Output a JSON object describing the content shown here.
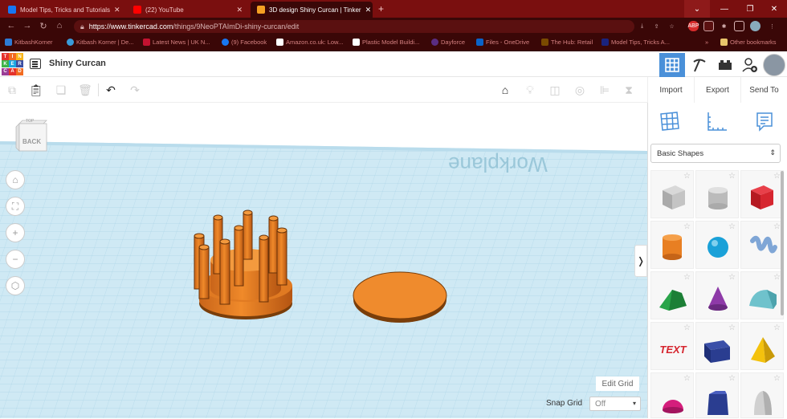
{
  "browser": {
    "tabs": [
      {
        "title": "Model Tips, Tricks and Tutorials",
        "close": "✕",
        "color": "#1877f2"
      },
      {
        "title": "(22) YouTube",
        "close": "✕",
        "color": "#ff0000"
      },
      {
        "title": "3D design Shiny Curcan | Tinker",
        "close": "✕",
        "color": "#f4a023"
      }
    ],
    "new_tab": "+",
    "url_host": "https://www.tinkercad.com",
    "url_path": "/things/9NeoPTAImDi-shiny-curcan/edit",
    "extension_abp": "ABP",
    "bookmarks": [
      {
        "label": "KitbashKorner",
        "color": "#2d7bd6"
      },
      {
        "label": "Kitbash Korner | De...",
        "color": "#3a9bd9"
      },
      {
        "label": "Latest News | UK N...",
        "color": "#c41230"
      },
      {
        "label": "(9) Facebook",
        "color": "#1877f2"
      },
      {
        "label": "Amazon.co.uk: Low...",
        "color": "#222222"
      },
      {
        "label": "Plastic Model Buildi...",
        "color": "#222222"
      },
      {
        "label": "Dayforce",
        "color": "#5a2d82"
      },
      {
        "label": "Files - OneDrive",
        "color": "#0a63c9"
      },
      {
        "label": "The Hub: Retail",
        "color": "#7a4a00"
      },
      {
        "label": "Model Tips, Tricks A...",
        "color": "#1a237e"
      }
    ],
    "bookmarks_more": "»",
    "other_bookmarks": "Other bookmarks"
  },
  "app": {
    "logo_letters": [
      "TIN",
      "KER",
      "CAD"
    ],
    "logo_cells": [
      "T",
      "I",
      "N",
      "K",
      "E",
      "R",
      "C",
      "A",
      "D"
    ],
    "logo_colors": [
      "#e4322b",
      "#f26b21",
      "#f9b51a",
      "#3eb449",
      "#1ba7e2",
      "#3c4fa3",
      "#9a3d96",
      "#e4322b",
      "#f26b21"
    ],
    "design_title": "Shiny Curcan",
    "import_label": "Import",
    "export_label": "Export",
    "send_to_label": "Send To",
    "shape_category": "Basic Shapes",
    "view_cube_label": "BACK",
    "view_cube_top": "TOP",
    "workplane_text": "Workplane",
    "edit_grid_label": "Edit Grid",
    "snap_grid_label": "Snap Grid",
    "snap_grid_value": "Off",
    "collapse_icon": "❭"
  },
  "colors": {
    "accent_blue": "#4a90d9",
    "grid_blue": "#c4e4f2",
    "shape_orange": "#e87f22",
    "shape_orange_dark": "#7a3e0a",
    "tab_bar": "#7a0f0f"
  }
}
